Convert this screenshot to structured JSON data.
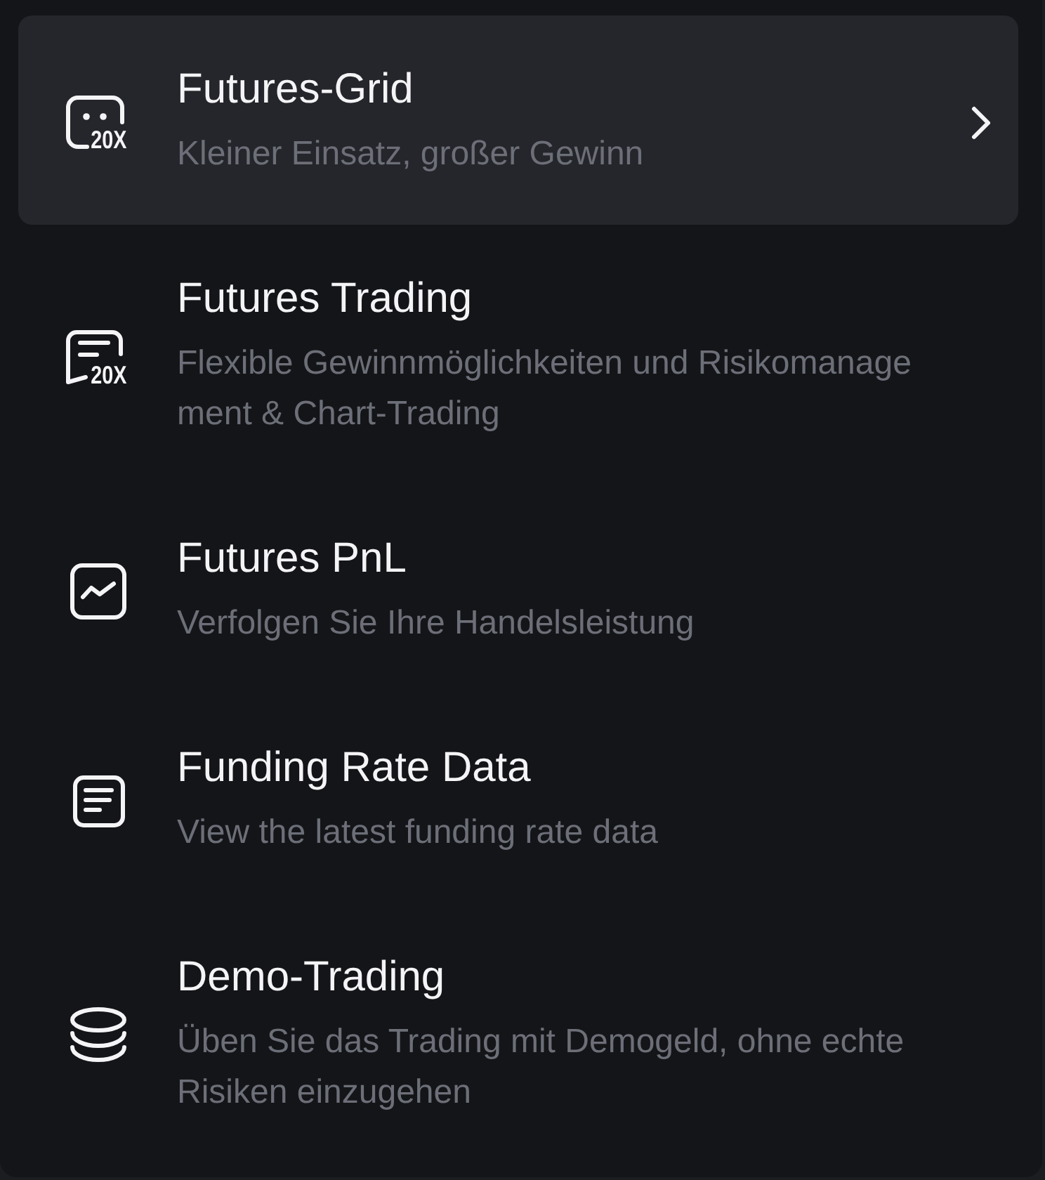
{
  "menu": {
    "items": [
      {
        "title": "Futures-Grid",
        "subtitle": "Kleiner Einsatz, großer Gewinn",
        "icon_badge": "20X",
        "selected": true
      },
      {
        "title": "Futures Trading",
        "subtitle": "Flexible Gewinnmöglichkeiten und Risikomanagement & Chart-Trading",
        "icon_badge": "20X",
        "selected": false
      },
      {
        "title": "Futures PnL",
        "subtitle": "Verfolgen Sie Ihre Handelsleistung",
        "selected": false
      },
      {
        "title": "Funding Rate Data",
        "subtitle": "View the latest funding rate data",
        "selected": false
      },
      {
        "title": "Demo-Trading",
        "subtitle": "Üben Sie das Trading mit Demogeld, ohne echte Risiken einzugehen",
        "selected": false
      }
    ]
  }
}
